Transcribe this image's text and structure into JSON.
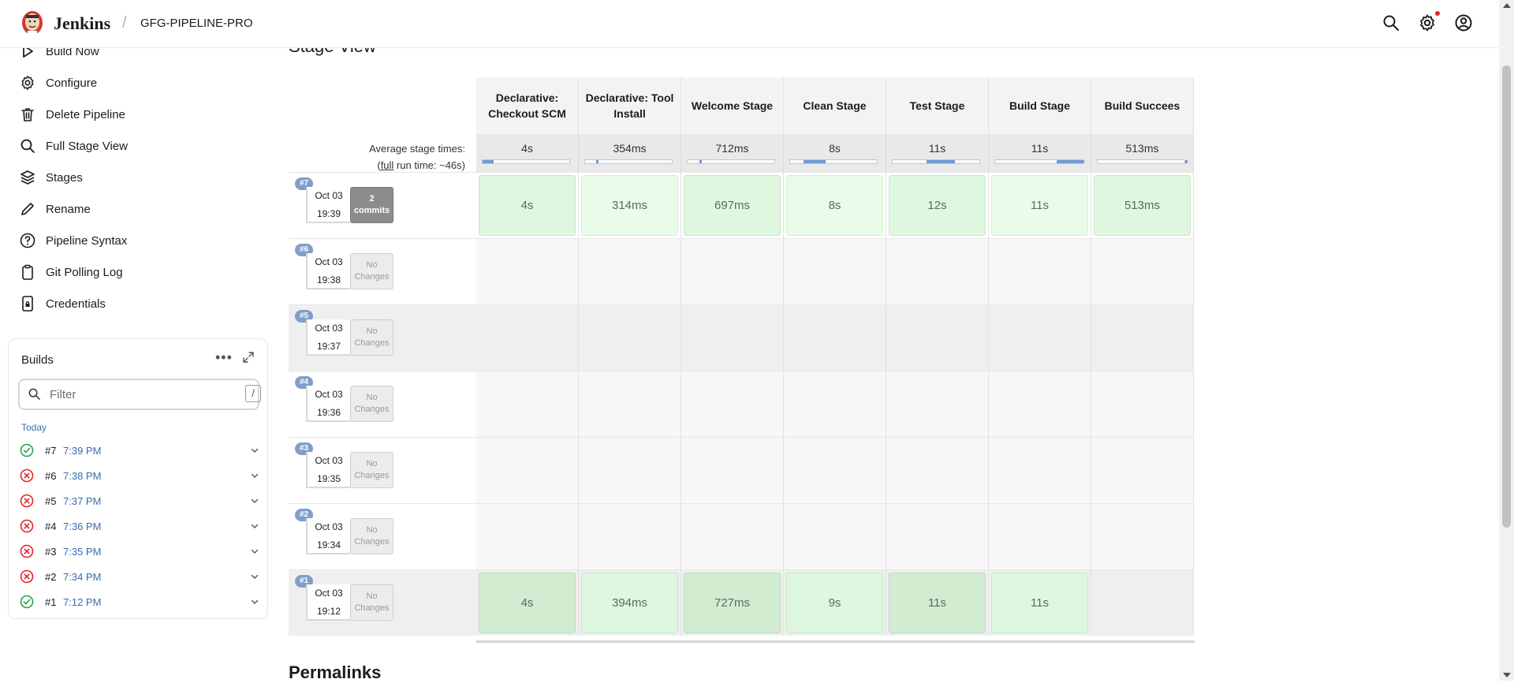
{
  "header": {
    "brand": "Jenkins",
    "separator": "/",
    "breadcrumb": "GFG-PIPELINE-PRO"
  },
  "sidebar": {
    "items": [
      {
        "label": "Build Now",
        "icon": "play-icon"
      },
      {
        "label": "Configure",
        "icon": "gear-icon"
      },
      {
        "label": "Delete Pipeline",
        "icon": "trash-icon"
      },
      {
        "label": "Full Stage View",
        "icon": "search-icon"
      },
      {
        "label": "Stages",
        "icon": "layers-icon"
      },
      {
        "label": "Rename",
        "icon": "pencil-icon"
      },
      {
        "label": "Pipeline Syntax",
        "icon": "help-circle-icon"
      },
      {
        "label": "Git Polling Log",
        "icon": "clipboard-icon"
      },
      {
        "label": "Credentials",
        "icon": "phone-lock-icon"
      }
    ]
  },
  "builds": {
    "title": "Builds",
    "more": "•••",
    "filter_placeholder": "Filter",
    "filter_shortcut": "/",
    "group": "Today",
    "list": [
      {
        "num": "#7",
        "time": "7:39 PM",
        "status": "success"
      },
      {
        "num": "#6",
        "time": "7:38 PM",
        "status": "failed"
      },
      {
        "num": "#5",
        "time": "7:37 PM",
        "status": "failed"
      },
      {
        "num": "#4",
        "time": "7:36 PM",
        "status": "failed"
      },
      {
        "num": "#3",
        "time": "7:35 PM",
        "status": "failed"
      },
      {
        "num": "#2",
        "time": "7:34 PM",
        "status": "failed"
      },
      {
        "num": "#1",
        "time": "7:12 PM",
        "status": "success"
      }
    ]
  },
  "main": {
    "stage_view_title": "Stage View",
    "permalinks_title": "Permalinks",
    "avg_label_line1": "Average stage times:",
    "avg_label_full": "full",
    "avg_label_line2_rest": " run time: ~46s)",
    "avg_label_open": "("
  },
  "stages": [
    {
      "name": "Declarative: Checkout SCM",
      "avg": "4s",
      "avg_fill_start": 0.0,
      "avg_fill_frac": 0.12
    },
    {
      "name": "Declarative: Tool Install",
      "avg": "354ms",
      "avg_fill_start": 0.12,
      "avg_fill_frac": 0.02
    },
    {
      "name": "Welcome Stage",
      "avg": "712ms",
      "avg_fill_start": 0.13,
      "avg_fill_frac": 0.03
    },
    {
      "name": "Clean Stage",
      "avg": "8s",
      "avg_fill_start": 0.15,
      "avg_fill_frac": 0.25
    },
    {
      "name": "Test Stage",
      "avg": "11s",
      "avg_fill_start": 0.38,
      "avg_fill_frac": 0.32
    },
    {
      "name": "Build Stage",
      "avg": "11s",
      "avg_fill_start": 0.69,
      "avg_fill_frac": 0.31
    },
    {
      "name": "Build Succees",
      "avg": "513ms",
      "avg_fill_start": 0.98,
      "avg_fill_frac": 0.02
    }
  ],
  "runs": [
    {
      "badge": "#7",
      "date": "Oct 03",
      "time": "19:39",
      "changes_line1": "2",
      "changes_line2": "commits",
      "has_commits": true,
      "row_bg": "white",
      "cells": [
        {
          "v": "4s",
          "s": "ok1"
        },
        {
          "v": "314ms",
          "s": "ok2"
        },
        {
          "v": "697ms",
          "s": "ok1"
        },
        {
          "v": "8s",
          "s": "ok2"
        },
        {
          "v": "12s",
          "s": "ok1"
        },
        {
          "v": "11s",
          "s": "ok2"
        },
        {
          "v": "513ms",
          "s": "ok1"
        }
      ]
    },
    {
      "badge": "#6",
      "date": "Oct 03",
      "time": "19:38",
      "changes_line1": "No",
      "changes_line2": "Changes",
      "has_commits": false,
      "row_bg": "light",
      "cells": []
    },
    {
      "badge": "#5",
      "date": "Oct 03",
      "time": "19:37",
      "changes_line1": "No",
      "changes_line2": "Changes",
      "has_commits": false,
      "row_bg": "grey",
      "cells": []
    },
    {
      "badge": "#4",
      "date": "Oct 03",
      "time": "19:36",
      "changes_line1": "No",
      "changes_line2": "Changes",
      "has_commits": false,
      "row_bg": "light",
      "cells": []
    },
    {
      "badge": "#3",
      "date": "Oct 03",
      "time": "19:35",
      "changes_line1": "No",
      "changes_line2": "Changes",
      "has_commits": false,
      "row_bg": "light",
      "cells": []
    },
    {
      "badge": "#2",
      "date": "Oct 03",
      "time": "19:34",
      "changes_line1": "No",
      "changes_line2": "Changes",
      "has_commits": false,
      "row_bg": "light",
      "cells": []
    },
    {
      "badge": "#1",
      "date": "Oct 03",
      "time": "19:12",
      "changes_line1": "No",
      "changes_line2": "Changes",
      "has_commits": false,
      "row_bg": "grey",
      "cells": [
        {
          "v": "4s",
          "s": "ok3"
        },
        {
          "v": "394ms",
          "s": "ok1"
        },
        {
          "v": "727ms",
          "s": "ok3"
        },
        {
          "v": "9s",
          "s": "ok1"
        },
        {
          "v": "11s",
          "s": "ok3"
        },
        {
          "v": "11s",
          "s": "ok1"
        },
        {
          "v": "",
          "s": "none"
        }
      ]
    }
  ],
  "colors": {
    "accent": "#3a6cad",
    "success": "#1ea64b",
    "failure": "#e5232a",
    "badge": "#7f9fca"
  }
}
